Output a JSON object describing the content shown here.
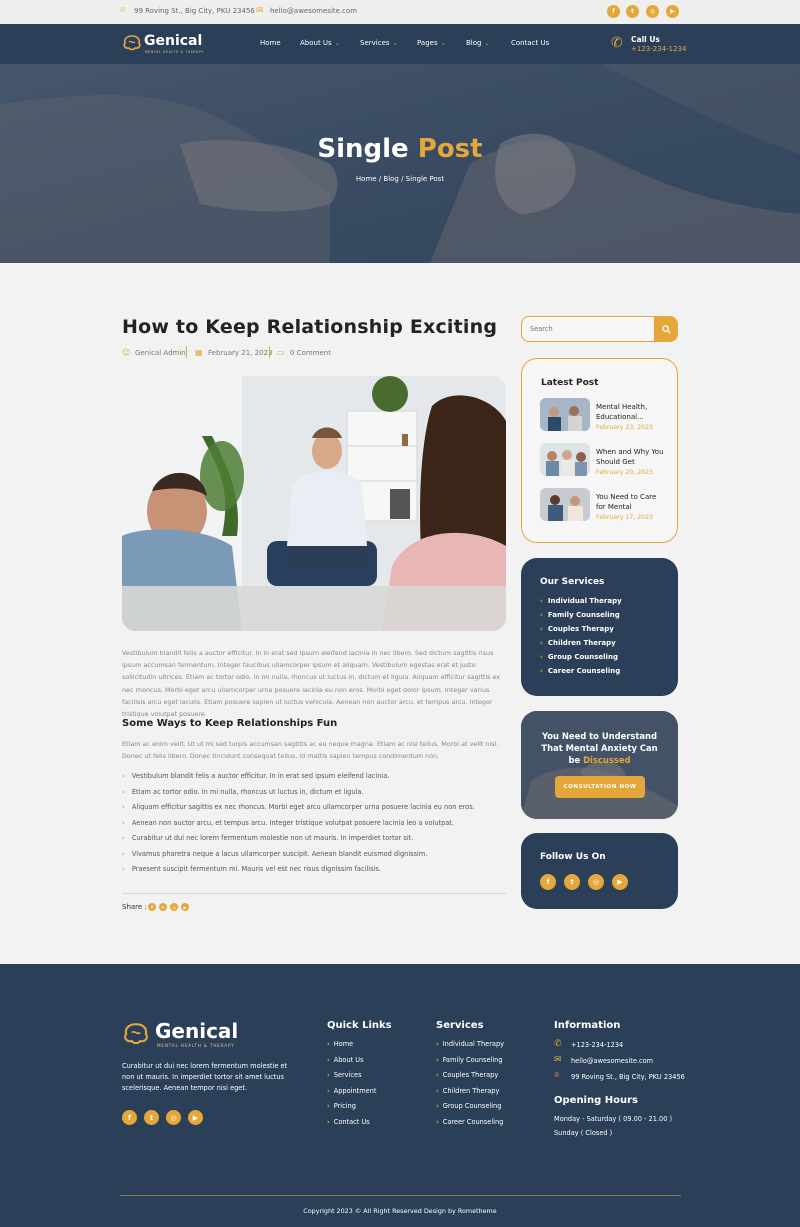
{
  "topbar": {
    "address": "99 Roving St., Big City, PKU 23456",
    "email": "hello@awesomesite.com",
    "social_icons": [
      "facebook-icon",
      "twitter-icon",
      "instagram-icon",
      "youtube-icon"
    ]
  },
  "brand": {
    "name": "Genical",
    "tagline": "MENTAL HEALTH & THERAPY"
  },
  "nav": {
    "items": [
      "Home",
      "About Us",
      "Services",
      "Pages",
      "Blog",
      "Contact Us"
    ],
    "call_label": "Call Us",
    "call_number": "+123-234-1234"
  },
  "hero": {
    "title_white": "Single",
    "title_accent": "Post",
    "breadcrumb": "Home / Blog / Single Post"
  },
  "post": {
    "title": "How to Keep Relationship Exciting",
    "author": "Genical Admin",
    "date": "February 21, 2023",
    "comments": "0 Comment",
    "body": "Vestibulum blandit felis a auctor efficitur. In in erat sed ipsum eleifend lacinia in nec libero. Sed dictum sagittis risus ipsum accumsan fermentum. Integer faucibus ullamcorper ipsum et aliquam. Vestibulum egestas erat et justo sollicitudin ultrices. Etiam ac tortor odio. In mi nulla, rhoncus ut luctus in, dictum et ligula. Aliquam efficitur sagittis ex nec rhoncus. Morbi eget arcu ullamcorper urna posuere lacinia eu non eros. Morbi eget dolor ipsum. Integer varius facilisis arcu eget iaculis. Etiam posuere sapien ut luctus vehicula. Aenean non auctor arcu, et tempus arcu. Integer tristique volutpat posuere.",
    "subheading": "Some Ways to Keep Relationships Fun",
    "body2": "Etiam ac enim velit. Ut ut mi sed turpis accumsan sagittis ac eu neque magna. Etiam ac nisi tellus. Morbi at velit nisl. Donec ut felis libero. Donec tincidunt consequat tellus, id mattis sapien tempus condimentum non.",
    "bullets": [
      "Vestibulum blandit felis a auctor efficitur. In in erat sed ipsum eleifend lacinia.",
      "Etiam ac tortor odio. In mi nulla, rhoncus ut luctus in, dictum et ligula.",
      "Aliquam efficitur sagittis ex nec rhoncus. Morbi eget arcu ullamcorper urna posuere lacinia eu non eros.",
      "Aenean non auctor arcu, et tempus arcu. Integer tristique volutpat posuere lacinia leo a volutpat.",
      "Curabitur ut dui nec lorem fermentum molestie non ut mauris. In imperdiet tortor sit.",
      "Vivamus pharetra neque a lacus ullamcorper suscipit. Aenean blandit euismod dignissim.",
      "Praesent suscipit fermentum mi. Mauris vel est nec risus dignissim facilisis."
    ],
    "share_label": "Share :"
  },
  "sidebar": {
    "search_placeholder": "Search",
    "latest_title": "Latest Post",
    "latest": [
      {
        "title": "Mental Health, Educational...",
        "date": "February 23, 2023"
      },
      {
        "title": "When and Why You Should Get",
        "date": "February 20, 2023"
      },
      {
        "title": "You Need to Care for Mental",
        "date": "February 17, 2023"
      }
    ],
    "services_title": "Our Services",
    "services": [
      "Individual Therapy",
      "Family Counseling",
      "Couples Therapy",
      "Children Therapy",
      "Group Counseling",
      "Career Counseling"
    ],
    "cta_line1": "You Need to Understand",
    "cta_line2": "That Mental Anxiety Can",
    "cta_line3_pre": "be",
    "cta_line3_accent": "Discussed",
    "cta_button": "CONSULTATION NOW",
    "follow_title": "Follow Us On"
  },
  "footer": {
    "about": "Curabitur ut dui nec lorem fermentum molestie  et non ut mauris. In imperdiet tortor sit amet luctus scelerisque. Aenean tempor nisi eget.",
    "quick_title": "Quick Links",
    "quick_links": [
      "Home",
      "About Us",
      "Services",
      "Appointment",
      "Pricing",
      "Contact Us"
    ],
    "services_title": "Services",
    "services": [
      "Individual Therapy",
      "Family Counseling",
      "Couples Therapy",
      "Children Therapy",
      "Group Counseling",
      "Career Counseling"
    ],
    "info_title": "Information",
    "phone": "+123-234-1234",
    "email": "hello@awesomesite.com",
    "address": "99 Roving St., Big City, PKU 23456",
    "hours_title": "Opening Hours",
    "hours_1": "Monday - Saturday ( 09.00 - 21.00 )",
    "hours_2": "Sunday ( Closed )",
    "copyright": "Copyright 2023 © All Right Reserved Design by Rometheme"
  },
  "colors": {
    "accent": "#e6a73a",
    "navy": "#2b3f58",
    "bg": "#f2f2f2"
  }
}
